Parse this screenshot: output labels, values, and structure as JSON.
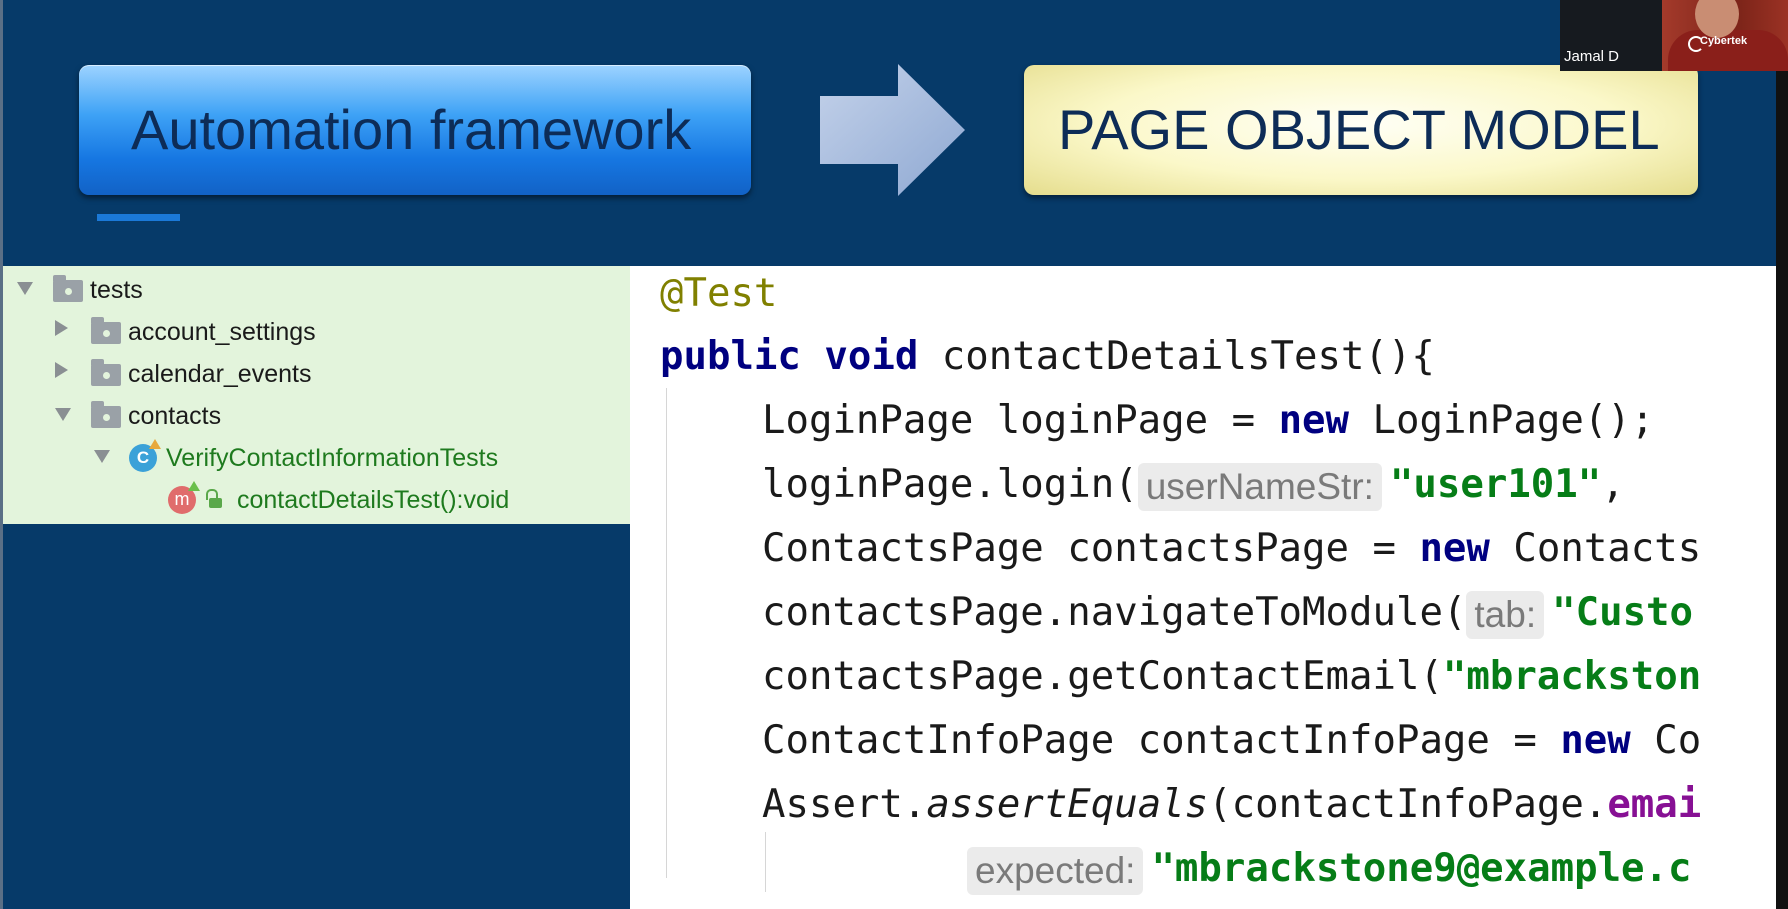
{
  "slide": {
    "left_box": "Automation framework",
    "right_box": "PAGE OBJECT MODEL",
    "colors": {
      "background": "#063a69",
      "left_box": "#1677e2",
      "right_box": "#fbf8c9",
      "box_text": "#0d2c57"
    }
  },
  "webcam": {
    "participant_name": "Jamal D",
    "brand": "Cybertek"
  },
  "project_tree": {
    "root": "tests",
    "folders": [
      "account_settings",
      "calendar_events",
      "contacts"
    ],
    "class_name": "VerifyContactInformationTests",
    "method_name": "contactDetailsTest():void",
    "class_icon": "C",
    "method_icon": "m"
  },
  "code": {
    "annotation": "@Test",
    "l2": {
      "kw1": "public",
      "kw2": "void",
      "rest": "contactDetailsTest(){"
    },
    "l3": {
      "a": "LoginPage loginPage = ",
      "kw": "new",
      "b": "LoginPage();"
    },
    "l4": {
      "a": "loginPage.login(",
      "hint": "userNameStr:",
      "str": "\"user101\"",
      "b": ", "
    },
    "l5": {
      "a": "ContactsPage contactsPage = ",
      "kw": "new",
      "b": "Contacts"
    },
    "l6": {
      "a": "contactsPage.navigateToModule(",
      "hint": "tab:",
      "str": "\"Custo"
    },
    "l7": {
      "a": "contactsPage.getContactEmail(",
      "str": "\"mbrackston"
    },
    "l8": {
      "a": "ContactInfoPage contactInfoPage = ",
      "kw": "new",
      "b": "Co"
    },
    "l9": {
      "a": "Assert.",
      "it": "assertEquals",
      "b": "(contactInfoPage.",
      "fld": "emai"
    },
    "l10": {
      "hint": "expected:",
      "str": "\"mbrackstone9@example.c"
    }
  }
}
